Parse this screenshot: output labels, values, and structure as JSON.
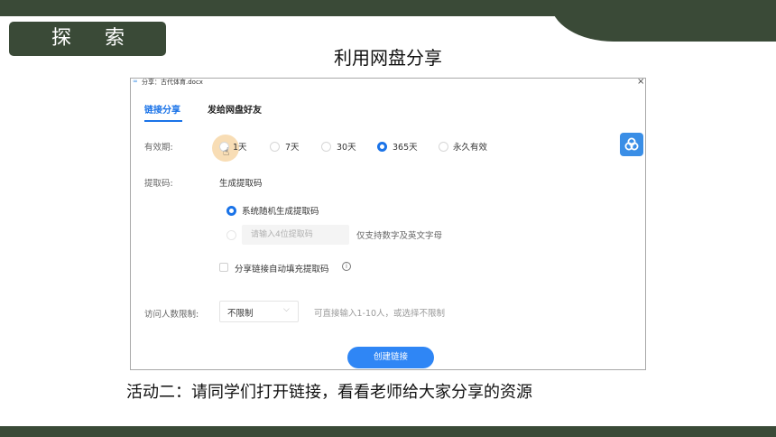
{
  "slide": {
    "section_tag": "探 索",
    "title": "利用网盘分享",
    "caption": "活动二：请同学们打开链接，看看老师给大家分享的资源"
  },
  "dialog": {
    "title": "分享：古代体育.docx",
    "close_icon": "close-icon",
    "tabs": [
      {
        "label": "链接分享",
        "active": true
      },
      {
        "label": "发给网盘好友",
        "active": false
      }
    ],
    "validity": {
      "label": "有效期:",
      "options": [
        {
          "label": "1天",
          "selected": false
        },
        {
          "label": "7天",
          "selected": false
        },
        {
          "label": "30天",
          "selected": false
        },
        {
          "label": "365天",
          "selected": true
        },
        {
          "label": "永久有效",
          "selected": false
        }
      ]
    },
    "extract_code": {
      "label": "提取码:",
      "heading": "生成提取码",
      "random_option": "系统随机生成提取码",
      "random_selected": true,
      "custom_placeholder": "请输入4位提取码",
      "hint": "仅支持数字及英文字母",
      "autofill_label": "分享链接自动填充提取码",
      "autofill_checked": false
    },
    "visitor_limit": {
      "label": "访问人数限制:",
      "selected": "不限制",
      "hint": "可直接输入1-10人，或选择不限制"
    },
    "create_button": "创建链接",
    "side_icon": "cloud-share-icon"
  },
  "colors": {
    "theme_dark_green": "#3a4a37",
    "accent_blue": "#1a73e8",
    "button_blue": "#2f86f5"
  }
}
